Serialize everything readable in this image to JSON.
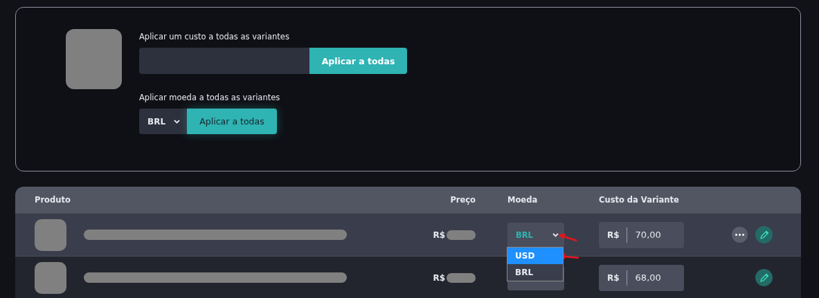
{
  "cost_panel": {
    "cost_label": "Aplicar um custo a todas as variantes",
    "cost_button": "Aplicar a todas",
    "currency_label": "Aplicar moeda a todas as variantes",
    "currency_value": "BRL",
    "currency_button": "Aplicar a todas"
  },
  "table": {
    "columns": [
      "Produto",
      "Preço",
      "Moeda",
      "Custo da Variante"
    ],
    "rows": [
      {
        "highlighted": true,
        "price_prefix": "R$",
        "currency": "BRL",
        "cost_prefix": "R$",
        "cost": "70,00",
        "more_menu": true,
        "dropdown": {
          "options": [
            {
              "label": "USD",
              "selected": true
            },
            {
              "label": "BRL",
              "selected": false
            }
          ]
        }
      },
      {
        "highlighted": false,
        "price_prefix": "R$",
        "cost_prefix": "R$",
        "cost": "68,00",
        "more_menu": false
      }
    ]
  }
}
